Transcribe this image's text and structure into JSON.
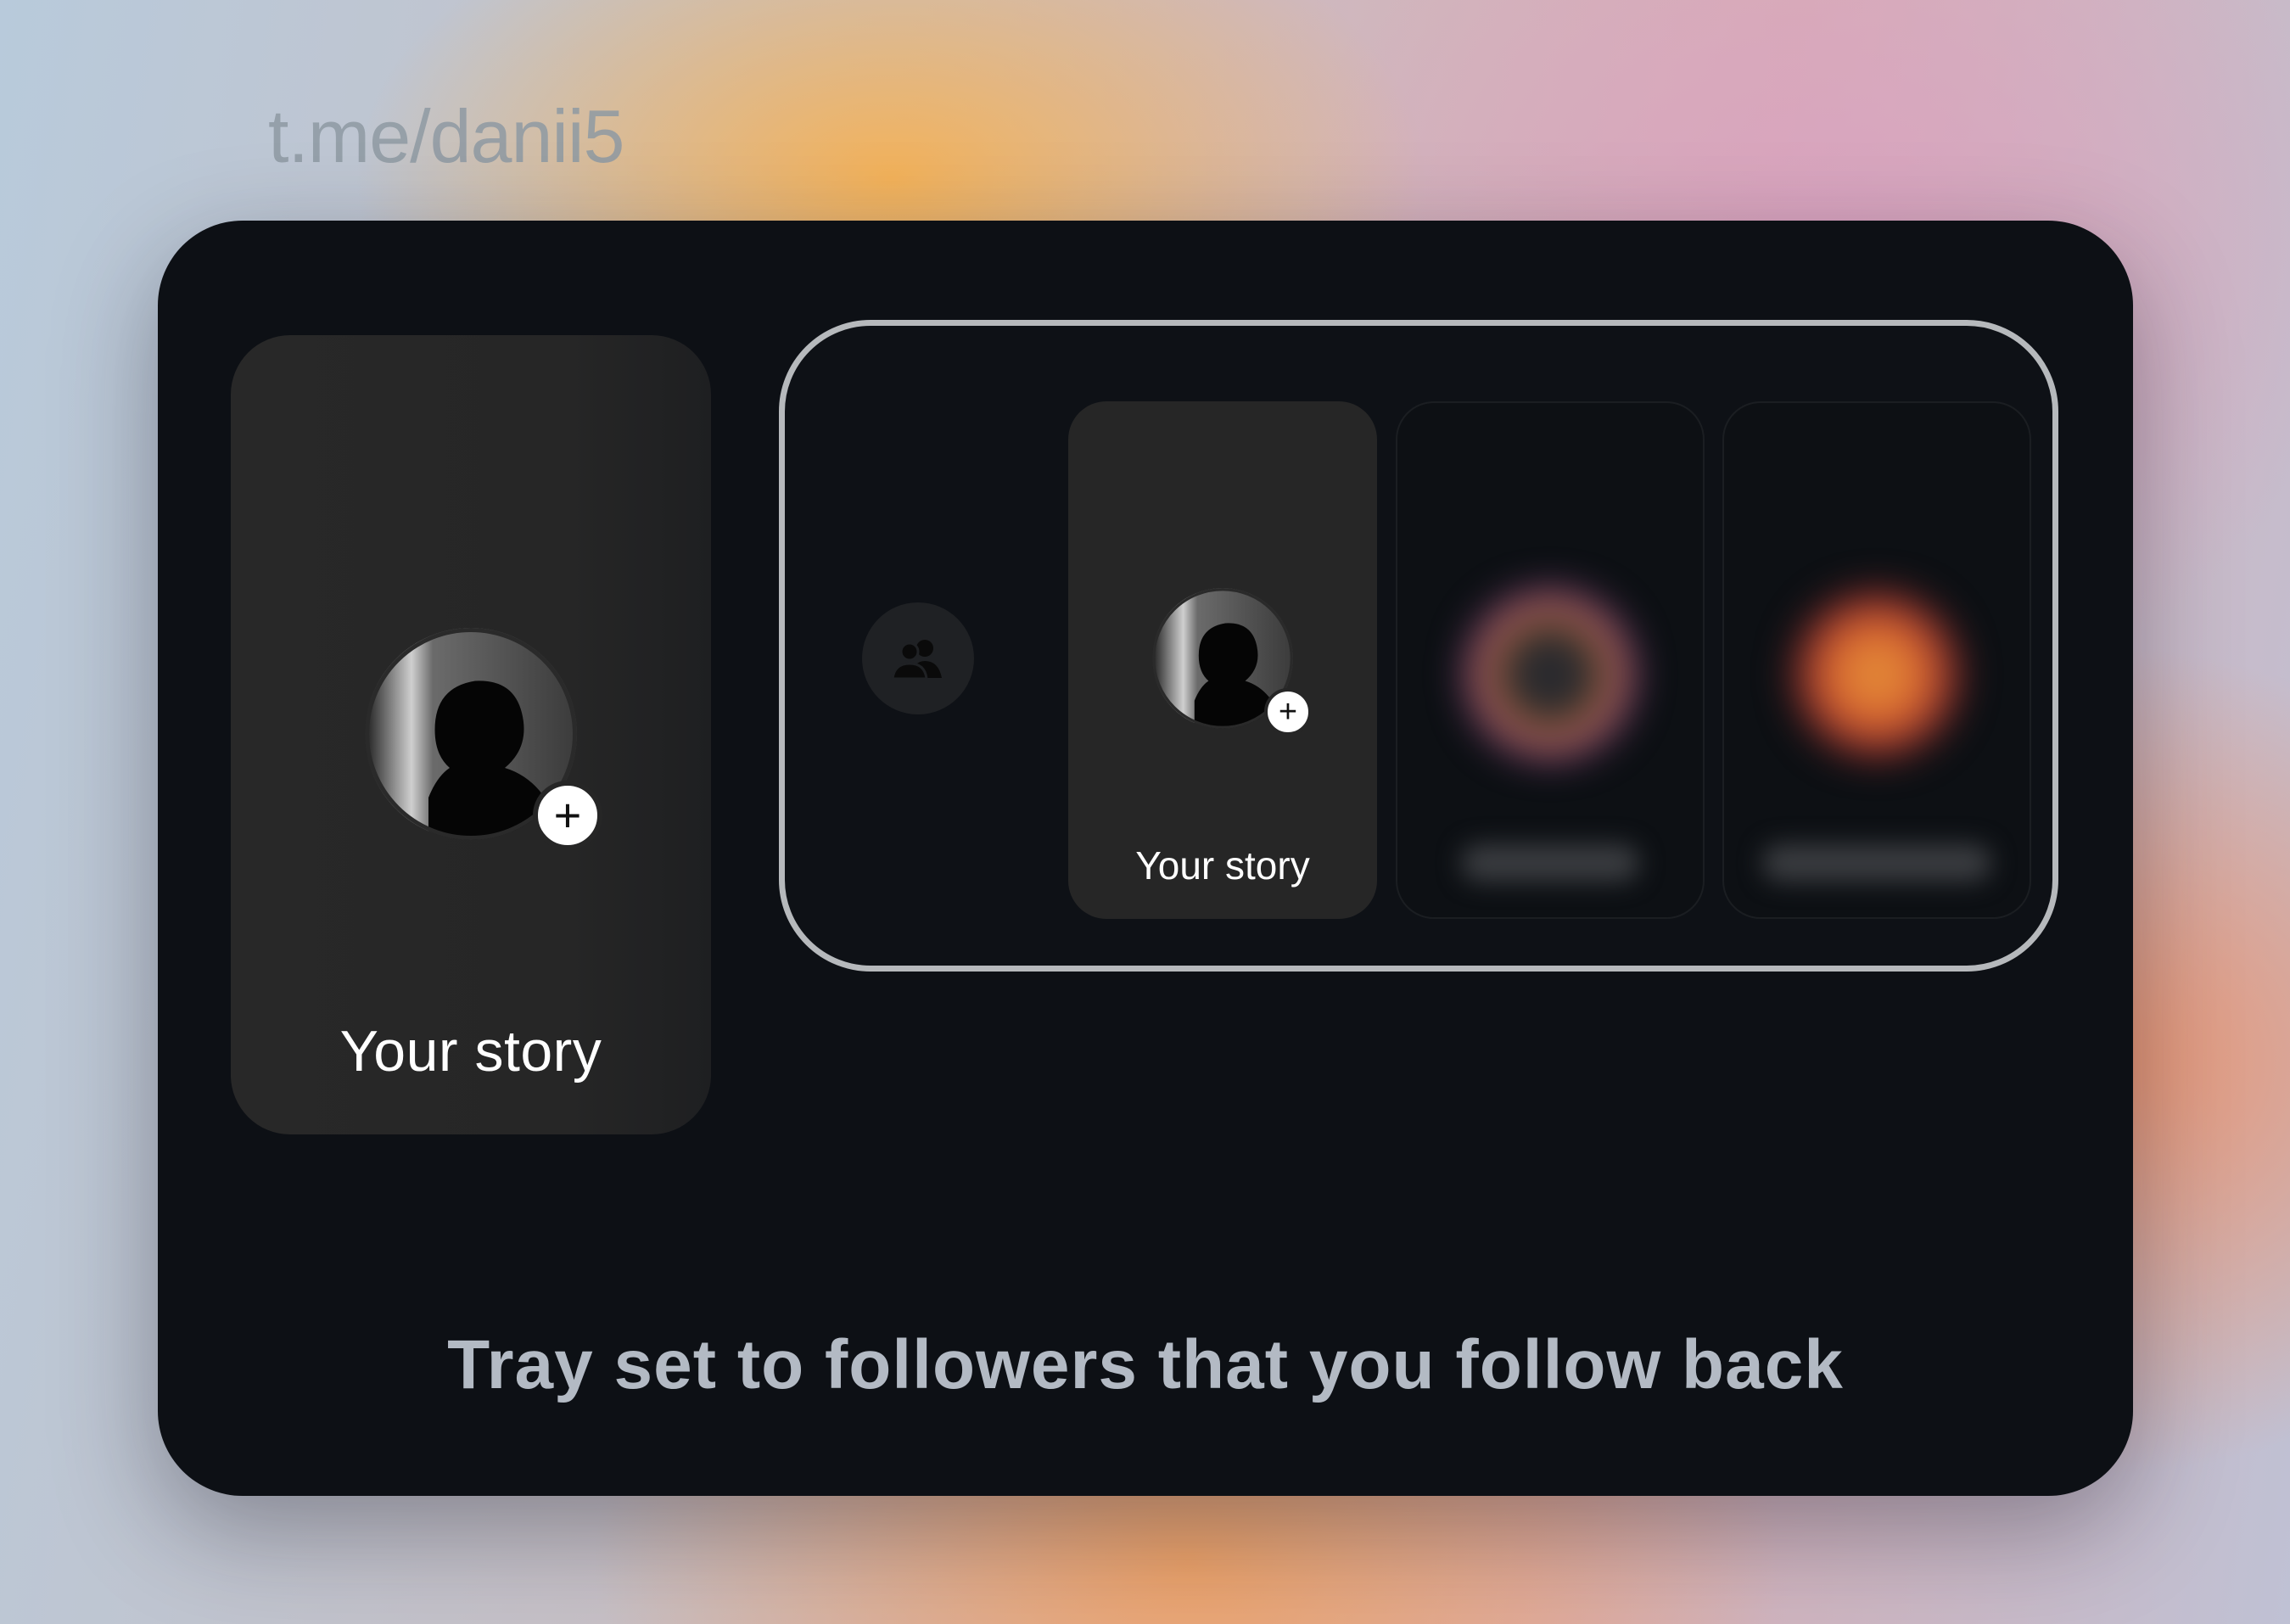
{
  "watermark": "t.me/danii5",
  "story_card": {
    "label": "Your story",
    "add_symbol": "+",
    "avatar_icon": "silhouette-avatar"
  },
  "tray": {
    "followers_icon": "followers-group-icon",
    "own_card": {
      "label": "Your story",
      "add_symbol": "+"
    }
  },
  "caption": "Tray set to followers that you follow back",
  "colors": {
    "panel": "#0d1015",
    "card": "#262626",
    "frame": "#b6b9bc",
    "caption": "#b3bac4"
  }
}
